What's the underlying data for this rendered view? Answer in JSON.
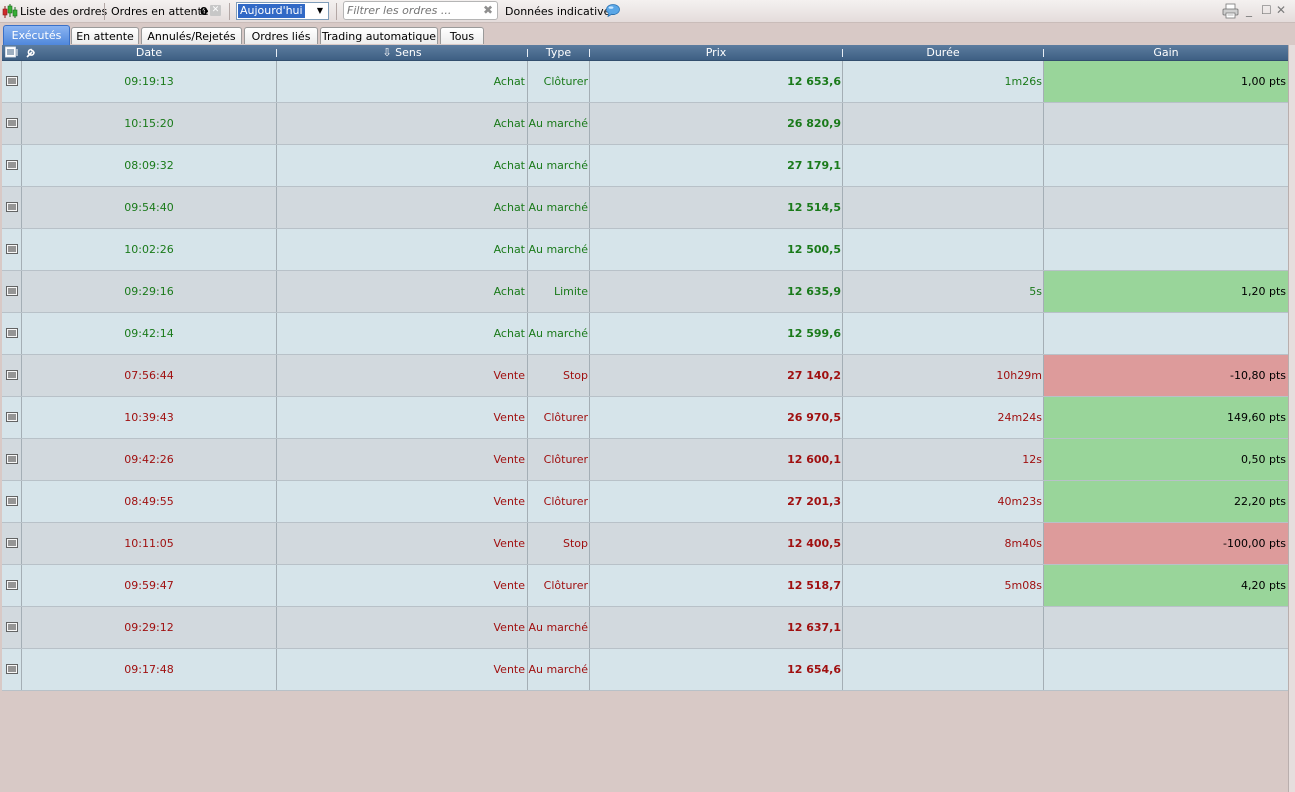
{
  "toolbar": {
    "orders_list_label": "Liste des ordres",
    "pending_label": "Ordres en attente",
    "pending_count": "0",
    "period_value": "Aujourd'hui",
    "filter_placeholder": "Filtrer les ordres ...",
    "indicative_label": "Données indicatives"
  },
  "tabs": [
    {
      "label": "Exécutés",
      "active": true
    },
    {
      "label": "En attente",
      "active": false
    },
    {
      "label": "Annulés/Rejetés",
      "active": false
    },
    {
      "label": "Ordres liés",
      "active": false
    },
    {
      "label": "Trading automatique",
      "active": false
    },
    {
      "label": "Tous",
      "active": false
    }
  ],
  "columns": {
    "date": "Date",
    "sens": "Sens",
    "type": "Type",
    "prix": "Prix",
    "duree": "Durée",
    "gain": "Gain"
  },
  "colors": {
    "buy_text": "#1a7a1a",
    "sell_text": "#a01010",
    "gain_positive": "#99d59a",
    "gain_negative": "#dd9b9b",
    "active_tab": "#4f87db"
  },
  "rows": [
    {
      "date": "09:19:13",
      "sens": "Achat",
      "type": "Clôturer",
      "prix": "12 653,6",
      "duree": "1m26s",
      "gain": "1,00 pts",
      "gain_status": "positive"
    },
    {
      "date": "10:15:20",
      "sens": "Achat",
      "type": "Au marché",
      "prix": "26 820,9",
      "duree": "",
      "gain": "",
      "gain_status": "none"
    },
    {
      "date": "08:09:32",
      "sens": "Achat",
      "type": "Au marché",
      "prix": "27 179,1",
      "duree": "",
      "gain": "",
      "gain_status": "none"
    },
    {
      "date": "09:54:40",
      "sens": "Achat",
      "type": "Au marché",
      "prix": "12 514,5",
      "duree": "",
      "gain": "",
      "gain_status": "none"
    },
    {
      "date": "10:02:26",
      "sens": "Achat",
      "type": "Au marché",
      "prix": "12 500,5",
      "duree": "",
      "gain": "",
      "gain_status": "none"
    },
    {
      "date": "09:29:16",
      "sens": "Achat",
      "type": "Limite",
      "prix": "12 635,9",
      "duree": "5s",
      "gain": "1,20 pts",
      "gain_status": "positive"
    },
    {
      "date": "09:42:14",
      "sens": "Achat",
      "type": "Au marché",
      "prix": "12 599,6",
      "duree": "",
      "gain": "",
      "gain_status": "none"
    },
    {
      "date": "07:56:44",
      "sens": "Vente",
      "type": "Stop",
      "prix": "27 140,2",
      "duree": "10h29m",
      "gain": "-10,80 pts",
      "gain_status": "negative"
    },
    {
      "date": "10:39:43",
      "sens": "Vente",
      "type": "Clôturer",
      "prix": "26 970,5",
      "duree": "24m24s",
      "gain": "149,60 pts",
      "gain_status": "positive"
    },
    {
      "date": "09:42:26",
      "sens": "Vente",
      "type": "Clôturer",
      "prix": "12 600,1",
      "duree": "12s",
      "gain": "0,50 pts",
      "gain_status": "positive"
    },
    {
      "date": "08:49:55",
      "sens": "Vente",
      "type": "Clôturer",
      "prix": "27 201,3",
      "duree": "40m23s",
      "gain": "22,20 pts",
      "gain_status": "positive"
    },
    {
      "date": "10:11:05",
      "sens": "Vente",
      "type": "Stop",
      "prix": "12 400,5",
      "duree": "8m40s",
      "gain": "-100,00 pts",
      "gain_status": "negative"
    },
    {
      "date": "09:59:47",
      "sens": "Vente",
      "type": "Clôturer",
      "prix": "12 518,7",
      "duree": "5m08s",
      "gain": "4,20 pts",
      "gain_status": "positive"
    },
    {
      "date": "09:29:12",
      "sens": "Vente",
      "type": "Au marché",
      "prix": "12 637,1",
      "duree": "",
      "gain": "",
      "gain_status": "none"
    },
    {
      "date": "09:17:48",
      "sens": "Vente",
      "type": "Au marché",
      "prix": "12 654,6",
      "duree": "",
      "gain": "",
      "gain_status": "none"
    }
  ]
}
